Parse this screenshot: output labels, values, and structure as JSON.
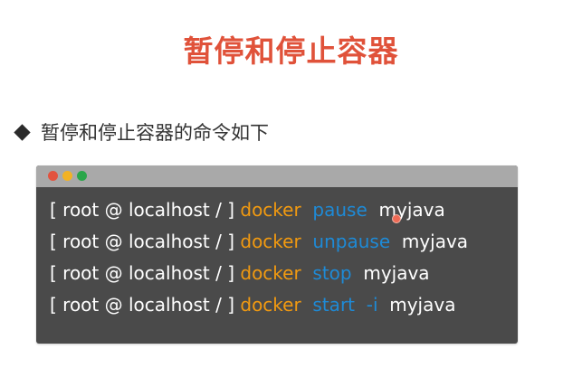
{
  "slide": {
    "title": "暂停和停止容器",
    "bullet_text": "暂停和停止容器的命令如下"
  },
  "terminal": {
    "window_dots": [
      "red",
      "yellow",
      "green"
    ],
    "lines": [
      {
        "prompt": "[ root @ localhost / ]",
        "command": "docker",
        "subcommand": "pause",
        "flag": "",
        "argument": "myjava"
      },
      {
        "prompt": "[ root @ localhost / ]",
        "command": "docker",
        "subcommand": "unpause",
        "flag": "",
        "argument": "myjava"
      },
      {
        "prompt": "[ root @ localhost / ]",
        "command": "docker",
        "subcommand": "stop",
        "flag": "",
        "argument": "myjava"
      },
      {
        "prompt": "[ root @ localhost / ]",
        "command": "docker",
        "subcommand": "start",
        "flag": "-i",
        "argument": "myjava"
      }
    ]
  },
  "colors": {
    "title": "#e0523a",
    "terminal_bg": "#4a4a4a",
    "terminal_bar": "#a9a9a9",
    "docker_keyword": "#f29a10",
    "subcommand": "#1e8ad6",
    "dot_red": "#e2533f",
    "dot_yellow": "#f2b224",
    "dot_green": "#2aa64a"
  },
  "icons": {
    "bullet": "diamond-bullet-icon",
    "cursor": "pointer-cursor-icon"
  }
}
